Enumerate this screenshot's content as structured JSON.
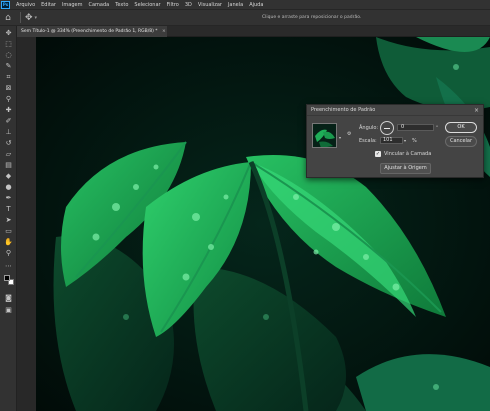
{
  "app": {
    "logo": "Ps"
  },
  "menu": [
    "Arquivo",
    "Editar",
    "Imagem",
    "Camada",
    "Texto",
    "Selecionar",
    "Filtro",
    "3D",
    "Visualizar",
    "Janela",
    "Ajuda"
  ],
  "options_bar": {
    "hint": "Clique e arraste para reposicionar o padrão."
  },
  "document_tab": {
    "title": "Sem Título-1 @ 334% (Preenchimento de Padrão 1, RGB/8) *",
    "close": "×"
  },
  "dialog": {
    "title": "Preenchimento de Padrão",
    "close": "×",
    "angle_label": "Ângulo:",
    "angle_value": "0",
    "angle_unit": "°",
    "scale_label": "Escala:",
    "scale_value": "101",
    "scale_unit": "%",
    "link_label": "Vincular à Camada",
    "link_checked": true,
    "snap_button": "Ajustar à Origem",
    "ok_button": "OK",
    "cancel_button": "Cancelar"
  },
  "icons": {
    "home": "home-icon",
    "move": "move-icon",
    "close": "close-icon",
    "gear": "gear-icon"
  },
  "colors": {
    "app_bg": "#282828",
    "panel": "#323232",
    "dialog": "#444444",
    "leaf_green": "#19b152"
  }
}
